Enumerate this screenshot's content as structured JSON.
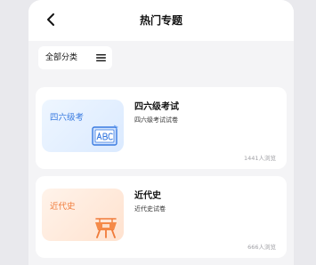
{
  "header": {
    "title": "热门专题",
    "back_icon": "chevron-left-icon"
  },
  "filter": {
    "label": "全部分类",
    "icon": "menu-icon"
  },
  "cards": [
    {
      "thumb_label": "四六级考",
      "thumb_icon": "abc-book-icon",
      "title": "四六级考试",
      "subtitle": "四六级考试试卷",
      "views": "1441人浏览",
      "accent": "#3a7be0"
    },
    {
      "thumb_label": "近代史",
      "thumb_icon": "ancient-bronze-vessel-icon",
      "title": "近代史",
      "subtitle": "近代史试卷",
      "views": "666人浏览",
      "accent": "#f07b3a"
    }
  ]
}
